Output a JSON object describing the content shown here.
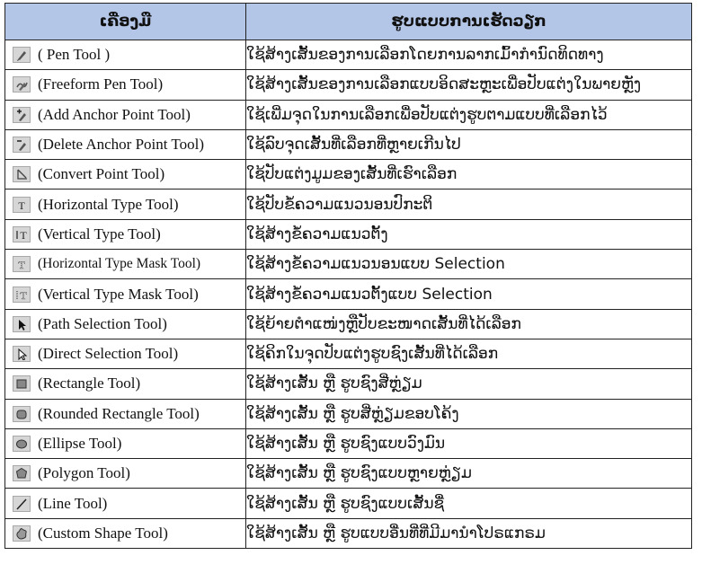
{
  "table": {
    "headers": [
      "ເຄື່ອງມື",
      "ຮູບແບບການເຮັດວຽກ"
    ],
    "rows": [
      {
        "icon": "pen-tool-icon",
        "tool": "( Pen Tool )",
        "desc": "ໃຊ້ສ້າງເສັ້ນຂອງການເລືອກໂດຍການລາກເມົ້າກຳນົດທິດທາງ"
      },
      {
        "icon": "freeform-pen-tool-icon",
        "tool": "(Freeform Pen Tool)",
        "desc": "ໃຊ້ສ້າງເສັ້ນຂອງການເລືອກແບບອິດສະຫຼະເພື່ອປັບແຕ່ງໃນພາຍຫຼັງ"
      },
      {
        "icon": "add-anchor-point-tool-icon",
        "tool": "(Add Anchor Point Tool)",
        "desc": "ໃຊ້ເພີ່ມຈຸດໃນການເລືອກເພື່ອປັບແຕ່ງຮູບຕາມແບບທີ່ເລືອກໄວ້"
      },
      {
        "icon": "delete-anchor-point-tool-icon",
        "tool": "(Delete Anchor Point Tool)",
        "desc": "ໃຊ້ລົບຈຸດເສັ້ນທີ່ເລືອກທີ່ຫຼາຍເກີນໄປ"
      },
      {
        "icon": "convert-point-tool-icon",
        "tool": "(Convert Point Tool)",
        "desc": "ໃຊ້ປັບແຕ່ງມູມຂອງເສັ້ນທີ່ເຮົາເລືອກ"
      },
      {
        "icon": "horizontal-type-tool-icon",
        "tool": "(Horizontal Type Tool)",
        "desc": "ໃຊ້ປັບຂໍ້ຄວາມແນວນອນປົກະຕິ"
      },
      {
        "icon": "vertical-type-tool-icon",
        "tool": "(Vertical Type Tool)",
        "desc": "ໃຊ້ສ້າງຂໍ້ຄວາມແນວຕັ້ງ"
      },
      {
        "icon": "horizontal-type-mask-tool-icon",
        "tool": "(Horizontal Type Mask Tool)",
        "desc": "ໃຊ້ສ້າງຂໍ້ຄວາມແນວນອນແບບ Selection",
        "small": true
      },
      {
        "icon": "vertical-type-mask-tool-icon",
        "tool": "(Vertical Type Mask Tool)",
        "desc": "ໃຊ້ສ້າງຂໍ້ຄວາມແນວຕັ້ງແບບ Selection"
      },
      {
        "icon": "path-selection-tool-icon",
        "tool": "(Path Selection Tool)",
        "desc": "ໃຊ້ຍ້າຍຕຳແໜ່ງຫຼືປັບຂະໜາດເສັ້ນທີ່ໄດ້ເລືອກ"
      },
      {
        "icon": "direct-selection-tool-icon",
        "tool": "(Direct Selection Tool)",
        "desc": "ໃຊ້ຄິກໃນຈຸດປັບແຕ່ງຮູບຊົງເສັ້ນທີ່ໄດ້ເລືອກ"
      },
      {
        "icon": "rectangle-tool-icon",
        "tool": "(Rectangle Tool)",
        "desc": "ໃຊ້ສ້າງເສັ້ນ ຫຼື ຮູບຊົງສີ່ຫຼ່ຽມ"
      },
      {
        "icon": "rounded-rectangle-tool-icon",
        "tool": "(Rounded Rectangle Tool)",
        "desc": "ໃຊ້ສ້າງເສັ້ນ ຫຼື ຮູບສີ່ຫຼ່ຽມຂອບໂຄ້ງ"
      },
      {
        "icon": "ellipse-tool-icon",
        "tool": "(Ellipse Tool)",
        "desc": "ໃຊ້ສ້າງເສັ້ນ ຫຼື ຮູບຊົງແບບວົງມົນ"
      },
      {
        "icon": "polygon-tool-icon",
        "tool": "(Polygon Tool)",
        "desc": "ໃຊ້ສ້າງເສັ້ນ ຫຼື ຮູບຊົງແບບຫຼາຍຫຼ່ຽມ"
      },
      {
        "icon": "line-tool-icon",
        "tool": "(Line Tool)",
        "desc": "ໃຊ້ສ້າງເສັ້ນ ຫຼື ຮູບຊົງແບບເສັ້ນຊື່"
      },
      {
        "icon": "custom-shape-tool-icon",
        "tool": "(Custom Shape Tool)",
        "desc": "ໃຊ້ສ້າງເສັ້ນ ຫຼື ຮູບແບບອື່ນທີ່ທີ່ມີມານຳໂປຣແກຣມ"
      }
    ]
  }
}
